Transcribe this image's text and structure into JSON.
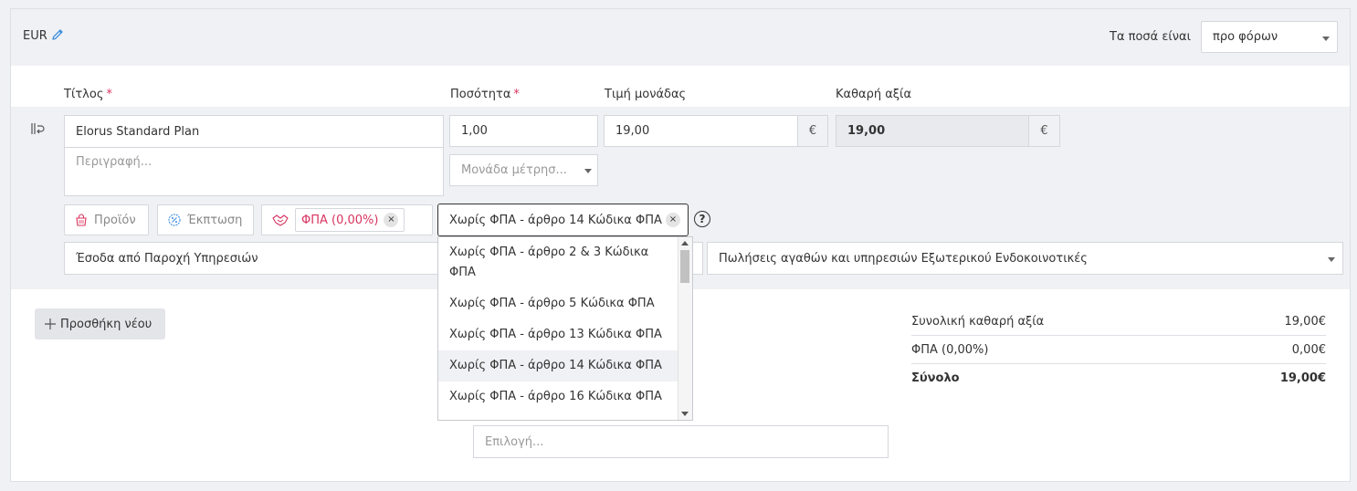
{
  "header": {
    "currency": "EUR",
    "amounts_label": "Τα ποσά είναι",
    "amounts_value": "προ φόρων"
  },
  "columns": {
    "title": "Τίτλος",
    "quantity": "Ποσότητα",
    "unit_price": "Τιμή μονάδας",
    "net_value": "Καθαρή αξία",
    "required_mark": "*"
  },
  "line": {
    "title_value": "Elorus Standard Plan",
    "description_placeholder": "Περιγραφή...",
    "quantity_value": "1,00",
    "unit_placeholder": "Μονάδα μέτρησ...",
    "unit_price_value": "19,00",
    "currency_symbol": "€",
    "net_value": "19,00",
    "product_button": "Προϊόν",
    "discount_button": "Έκπτωση",
    "vat_tag": "ΦΠΑ (0,00%)",
    "vat_exemption_selected": "Χωρίς ΦΠΑ - άρθρο 14 Κώδικα ΦΠΑ",
    "income_category": "Έσοδα από Παροχή Υπηρεσιών",
    "income_classification": "Πωλήσεις αγαθών και υπηρεσιών Εξωτερικού Ενδοκοινοτικές",
    "remove_symbol": "×",
    "help_symbol": "?"
  },
  "dropdown": {
    "items": [
      "Χωρίς ΦΠΑ - άρθρο 2 & 3 Κώδικα ΦΠΑ",
      "Χωρίς ΦΠΑ - άρθρο 5 Κώδικα ΦΠΑ",
      "Χωρίς ΦΠΑ - άρθρο 13 Κώδικα ΦΠΑ",
      "Χωρίς ΦΠΑ - άρθρο 14 Κώδικα ΦΠΑ",
      "Χωρίς ΦΠΑ - άρθρο 16 Κώδικα ΦΠΑ"
    ],
    "active_index": 3
  },
  "footer": {
    "add_new": "Προσθήκη νέου",
    "select_placeholder": "Επιλογή..."
  },
  "totals": {
    "net_label": "Συνολική καθαρή αξία",
    "net_value": "19,00€",
    "vat_label": "ΦΠΑ (0,00%)",
    "vat_value": "0,00€",
    "total_label": "Σύνολο",
    "total_value": "19,00€"
  },
  "colors": {
    "accent_pink": "#d8345f",
    "pencil_blue": "#3c8dde",
    "band_gray": "#f0f1f4"
  }
}
